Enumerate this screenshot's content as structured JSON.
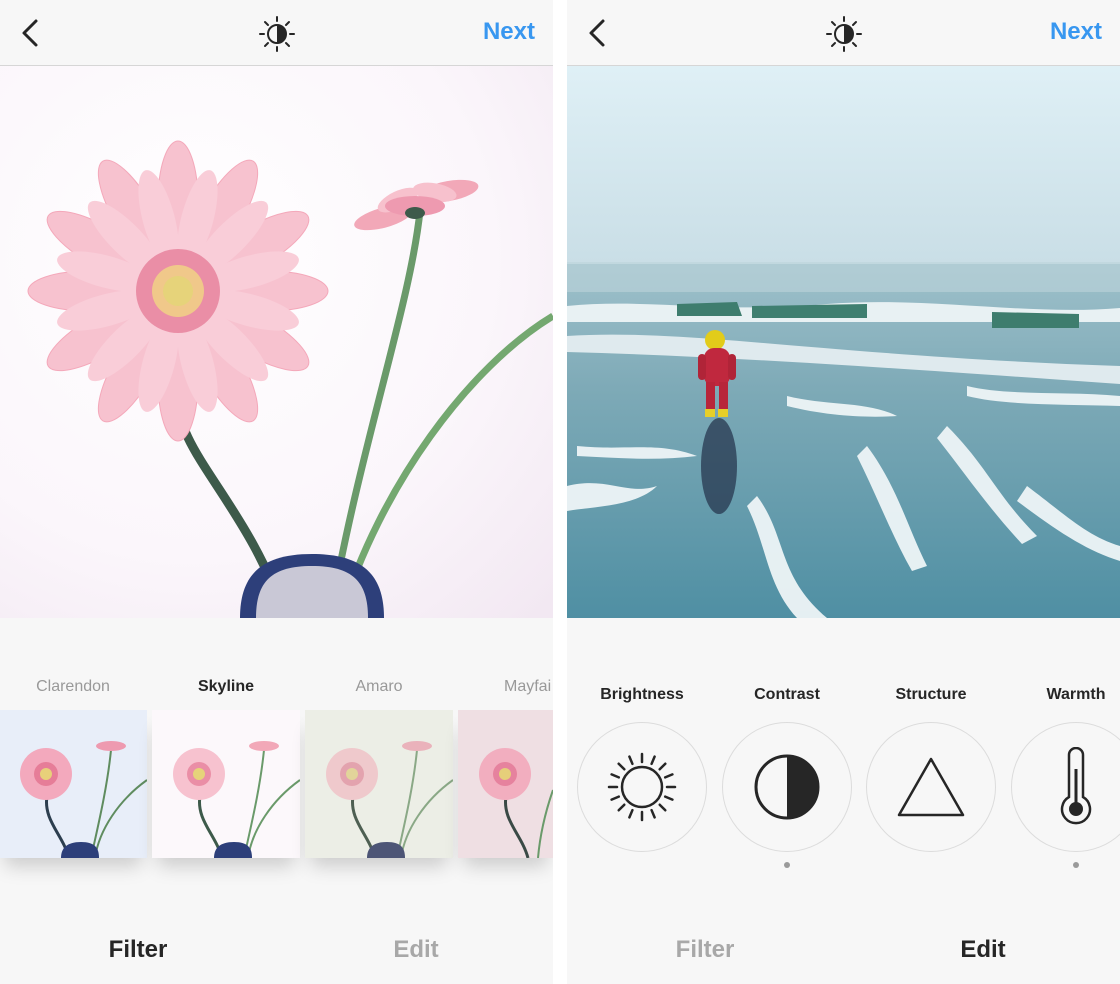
{
  "left_screen": {
    "header": {
      "back_icon": "chevron-left-icon",
      "lux_icon": "lux-sun-icon",
      "next_label": "Next"
    },
    "filters": [
      {
        "label": "Clarendon",
        "active": false
      },
      {
        "label": "Skyline",
        "active": true
      },
      {
        "label": "Amaro",
        "active": false
      },
      {
        "label": "Mayfai",
        "active": false
      }
    ],
    "tabs": {
      "filter_label": "Filter",
      "edit_label": "Edit",
      "active": "Filter"
    }
  },
  "right_screen": {
    "header": {
      "back_icon": "chevron-left-icon",
      "lux_icon": "lux-sun-icon",
      "next_label": "Next"
    },
    "tools": [
      {
        "label": "Brightness",
        "icon": "sun-icon"
      },
      {
        "label": "Contrast",
        "icon": "contrast-icon"
      },
      {
        "label": "Structure",
        "icon": "triangle-icon"
      },
      {
        "label": "Warmth",
        "icon": "thermometer-icon"
      }
    ],
    "tabs": {
      "filter_label": "Filter",
      "edit_label": "Edit",
      "active": "Edit"
    }
  },
  "colors": {
    "accent": "#3897f0",
    "active_text": "#262626",
    "inactive_text": "#a8a8a8"
  }
}
